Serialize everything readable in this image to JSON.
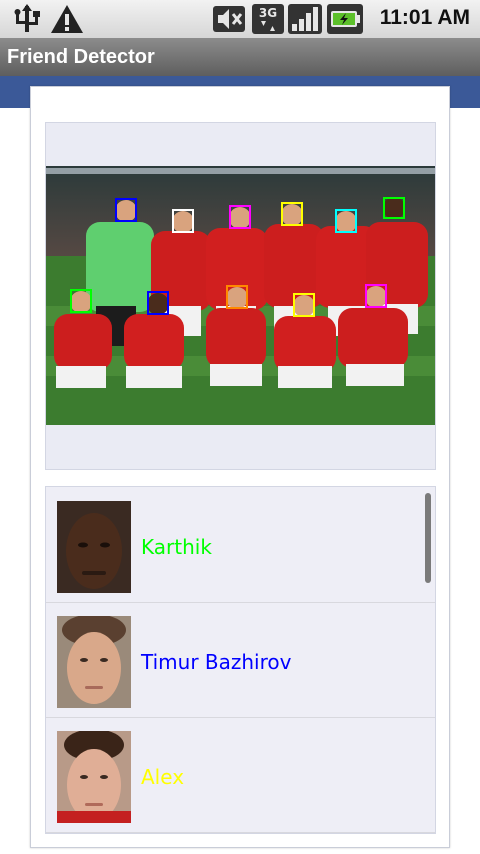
{
  "status_bar": {
    "time": "11:01 AM",
    "icons": [
      "usb-icon",
      "warning-icon",
      "mute-icon",
      "3g-data-icon",
      "signal-icon",
      "battery-charging-icon"
    ]
  },
  "app": {
    "title": "Friend Detector"
  },
  "colors": {
    "accent_blue": "#3b5998",
    "face_colors": [
      "#0000ff",
      "#ffffff",
      "#ff00ff",
      "#ffff00",
      "#00ffff",
      "#00ff00",
      "#00ff00",
      "#0000ff",
      "#ff8800",
      "#ffff00",
      "#ff00ff"
    ]
  },
  "friends": [
    {
      "name": "Karthik",
      "color": "#00ff00"
    },
    {
      "name": "Timur Bazhirov",
      "color": "#0000ff"
    },
    {
      "name": "Alex",
      "color": "#ffff00"
    }
  ]
}
